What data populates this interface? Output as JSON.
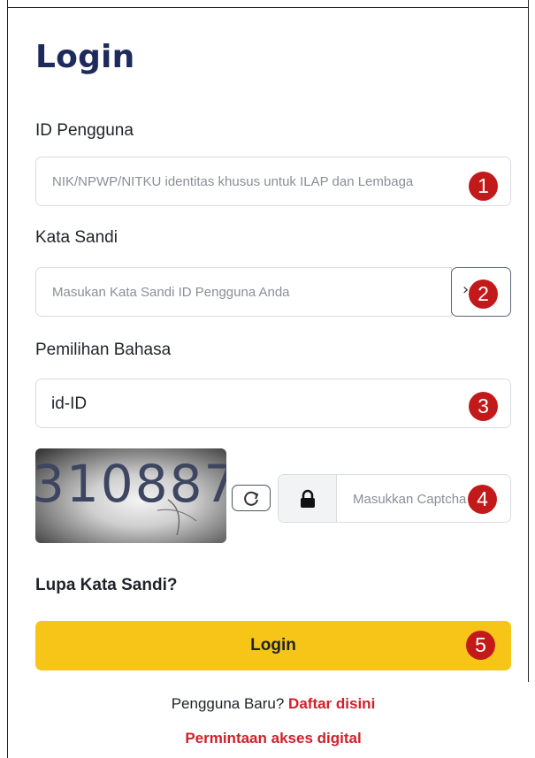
{
  "page": {
    "title": "Login"
  },
  "user_id": {
    "label": "ID Pengguna",
    "placeholder": "NIK/NPWP/NITKU identitas khusus untuk ILAP dan Lembaga",
    "badge": "1"
  },
  "password": {
    "label": "Kata Sandi",
    "placeholder": "Masukan Kata Sandi ID Pengguna Anda",
    "toggle_icon": "chevron-icon",
    "badge": "2"
  },
  "language": {
    "label": "Pemilihan Bahasa",
    "value": "id-ID",
    "badge": "3"
  },
  "captcha": {
    "code": "310887",
    "refresh_icon": "refresh-icon",
    "lock_icon": "lock-icon",
    "placeholder": "Masukkan Captcha",
    "badge": "4"
  },
  "forgot_password": "Lupa Kata Sandi?",
  "login_button": {
    "label": "Login",
    "badge": "5"
  },
  "register": {
    "prompt": "Pengguna Baru?",
    "link": "Daftar disini"
  },
  "digital_access_link": "Permintaan akses digital",
  "colors": {
    "title": "#1d2a5c",
    "button": "#f7c518",
    "link": "#d1202a",
    "badge": "#c21a1a"
  }
}
